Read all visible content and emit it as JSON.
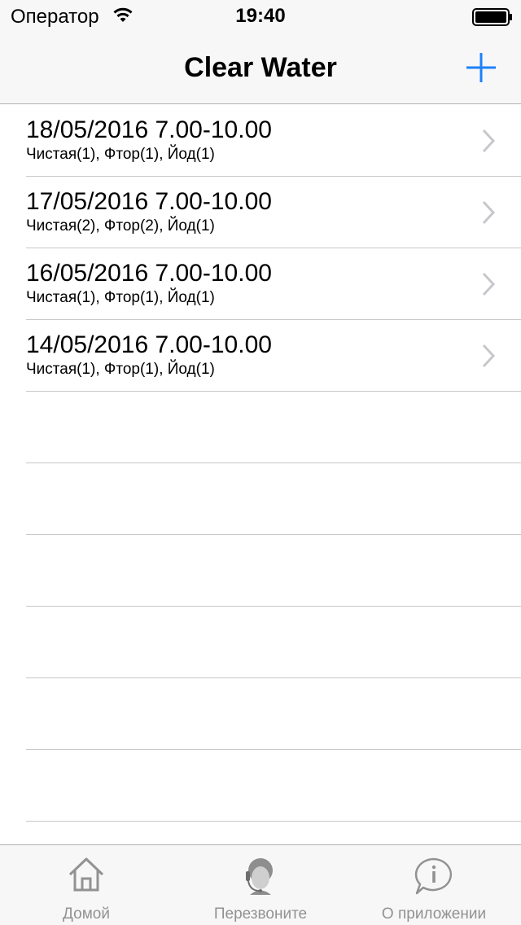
{
  "status_bar": {
    "carrier": "Оператор",
    "time": "19:40"
  },
  "nav": {
    "title": "Clear Water",
    "add_icon": "plus-icon",
    "accent_color": "#1a82fb"
  },
  "orders": [
    {
      "title": "18/05/2016 7.00-10.00",
      "subtitle": "Чистая(1), Фтор(1), Йод(1)"
    },
    {
      "title": "17/05/2016 7.00-10.00",
      "subtitle": "Чистая(2), Фтор(2), Йод(1)"
    },
    {
      "title": "16/05/2016 7.00-10.00",
      "subtitle": "Чистая(1), Фтор(1), Йод(1)"
    },
    {
      "title": "14/05/2016 7.00-10.00",
      "subtitle": "Чистая(1), Фтор(1), Йод(1)"
    }
  ],
  "tabbar": {
    "home_label": "Домой",
    "call_label": "Перезвоните",
    "about_label": "О приложении"
  }
}
